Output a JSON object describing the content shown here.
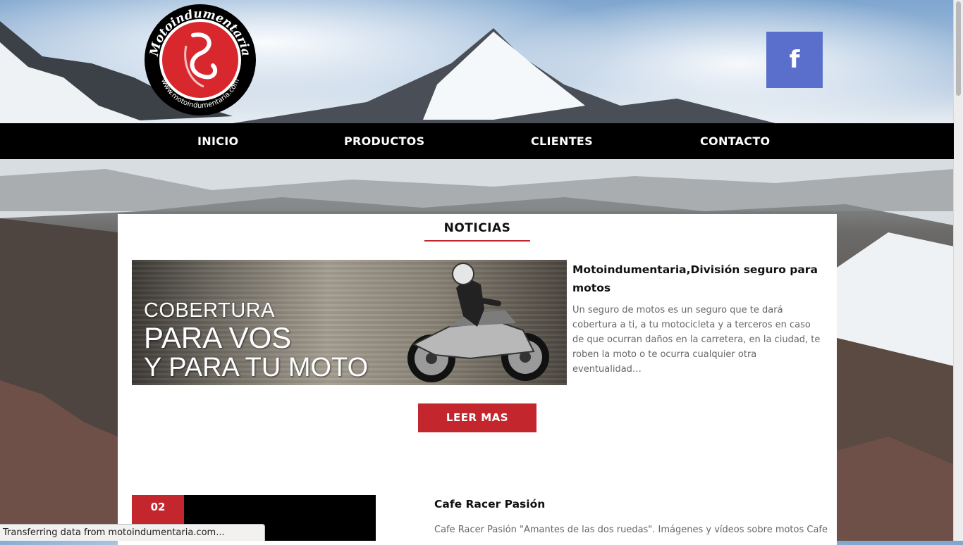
{
  "logo": {
    "ring_text_top": "Motoindumentaria",
    "ring_text_bottom": "www.motoindumentaria.com"
  },
  "social": {
    "facebook_glyph": "f"
  },
  "nav": {
    "items": [
      {
        "label": "INICIO"
      },
      {
        "label": "PRODUCTOS"
      },
      {
        "label": "CLIENTES"
      },
      {
        "label": "CONTACTO"
      }
    ]
  },
  "noticias": {
    "title": "NOTICIAS",
    "items": [
      {
        "image_lines": [
          "COBERTURA",
          "PARA VOS",
          "Y PARA TU MOTO"
        ],
        "title": "Motoindumentaria,División seguro para motos",
        "excerpt": "Un seguro de motos es un seguro que te dará cobertura a ti, a tu motocicleta y a terceros en caso de que ocurran daños en la carretera, en la ciudad, te roben la moto o te ocurra cualquier otra eventualidad…",
        "button_label": "LEER MAS"
      },
      {
        "date_label": "02",
        "title": "Cafe Racer Pasión",
        "excerpt": "Cafe Racer Pasión \"Amantes de las dos ruedas\". Imágenes y vídeos sobre motos Cafe"
      }
    ]
  },
  "status_bar": {
    "text": "Transferring data from motoindumentaria.com..."
  },
  "colors": {
    "accent": "#c4262e",
    "facebook": "#5a6fcc",
    "nav_bg": "#000000"
  }
}
